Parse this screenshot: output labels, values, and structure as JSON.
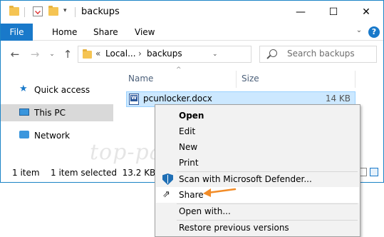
{
  "window": {
    "title": "backups",
    "controls": {
      "minimize": "—",
      "maximize": "☐",
      "close": "✕"
    }
  },
  "ribbon": {
    "tabs": [
      "File",
      "Home",
      "Share",
      "View"
    ],
    "help": "?"
  },
  "nav": {
    "address": {
      "prefix": "«",
      "crumbs": [
        "Local...",
        "backups"
      ]
    },
    "search_placeholder": "Search backups"
  },
  "sidebar": {
    "items": [
      {
        "label": "Quick access",
        "icon": "star-icon"
      },
      {
        "label": "This PC",
        "icon": "computer-icon",
        "selected": true
      },
      {
        "label": "Network",
        "icon": "network-icon"
      }
    ]
  },
  "columns": {
    "name": "Name",
    "size": "Size"
  },
  "files": [
    {
      "name": "pcunlocker.docx",
      "size": "14 KB",
      "icon": "word-doc-icon",
      "selected": true
    }
  ],
  "status": {
    "count": "1 item",
    "selection": "1 item selected  13.2 KB"
  },
  "watermark": "top-password.com",
  "context_menu": {
    "items": [
      {
        "label": "Open",
        "bold": true
      },
      {
        "label": "Edit"
      },
      {
        "label": "New"
      },
      {
        "label": "Print"
      },
      {
        "label": "Scan with Microsoft Defender...",
        "icon": "defender-shield-icon"
      },
      {
        "label": "Share",
        "icon": "share-icon",
        "highlighted": true
      },
      {
        "label": "Open with..."
      },
      {
        "label": "Restore previous versions"
      }
    ]
  },
  "colors": {
    "accent": "#1979ca",
    "selection": "#cce8ff",
    "annotation_arrow": "#f28c28"
  }
}
